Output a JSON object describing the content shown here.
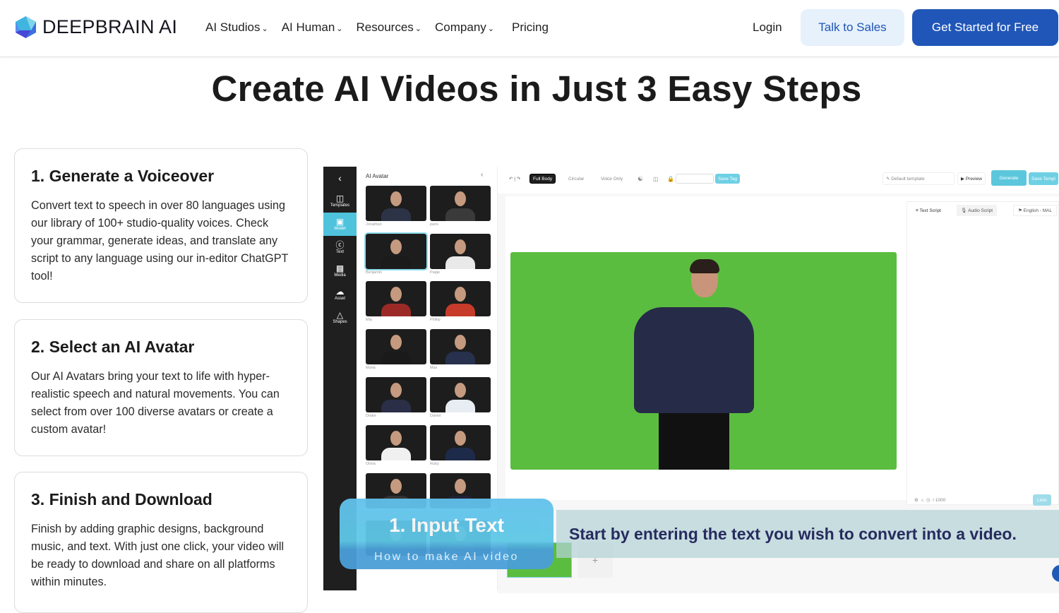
{
  "nav": {
    "brand": "DEEPBRAIN AI",
    "items": [
      {
        "label": "AI Studios",
        "dropdown": true
      },
      {
        "label": "AI Human",
        "dropdown": true
      },
      {
        "label": "Resources",
        "dropdown": true
      },
      {
        "label": "Company",
        "dropdown": true
      },
      {
        "label": "Pricing",
        "dropdown": false
      }
    ],
    "login": "Login",
    "talk_to_sales": "Talk to Sales",
    "get_started": "Get Started for Free"
  },
  "page_title": "Create AI Videos in Just 3 Easy Steps",
  "steps": [
    {
      "title": "1. Generate a Voiceover",
      "body": "Convert text to speech in over 80 languages using our library of 100+ studio-quality voices. Check your grammar, generate ideas, and translate any script to any language using our in-editor ChatGPT tool!"
    },
    {
      "title": "2. Select an AI Avatar",
      "body": "Our AI Avatars bring your text to life with hyper-realistic speech and natural movements. You can select from over 100 diverse avatars or create a custom avatar!"
    },
    {
      "title": "3. Finish and Download",
      "body": "Finish by adding graphic designs, background music, and text. With just one click, your video will be ready to download and share on all platforms within minutes."
    }
  ],
  "editor": {
    "sidebar": [
      {
        "label": "Templates",
        "icon": "layout-icon"
      },
      {
        "label": "Model",
        "icon": "person-icon",
        "active": true
      },
      {
        "label": "Text",
        "icon": "text-icon"
      },
      {
        "label": "Media",
        "icon": "image-icon"
      },
      {
        "label": "Asset",
        "icon": "cloud-upload-icon"
      },
      {
        "label": "Shapes",
        "icon": "shapes-icon"
      }
    ],
    "panel_title": "AI Avatar",
    "avatars": [
      "Jonathan",
      "paris",
      "Benjamin",
      "Paige",
      "Mia",
      "Phillip",
      "Maria",
      "Max",
      "Drake",
      "Daniel",
      "Olivia",
      "Ruby",
      "",
      "",
      "",
      ""
    ],
    "selected_avatar": "Benjamin",
    "toolbar": {
      "full_body": "Full Body",
      "circular": "Circular",
      "voice_only": "Voice Only",
      "save_tag": "Save Tag",
      "template_placeholder": "Default template",
      "preview": "Preview",
      "generate": "Generate",
      "save_template": "Save Templ"
    },
    "script_tabs": [
      "Text Script",
      "Audio Script"
    ],
    "language": "English - MAL",
    "char_count": "/ 1000",
    "listen": "Liste",
    "accent": "#4fc3dc"
  },
  "overlay": {
    "step_title": "1. Input Text",
    "subtitle": "How to make AI video",
    "caption": "Start by entering the text you wish to convert into a video."
  }
}
